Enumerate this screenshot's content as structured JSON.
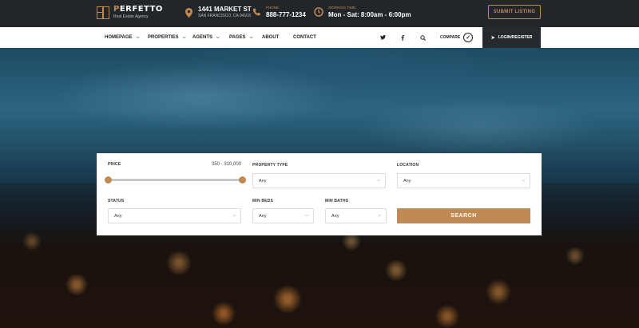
{
  "brand": {
    "first_letter": "P",
    "rest": "ERFETTO",
    "tagline": "Real Estate Agency"
  },
  "topbar": {
    "address_main": "1441 MARKET ST",
    "address_sub": "SAN FRANCISCO, CA 94103",
    "phone_label": "PHONE:",
    "phone": "888-777-1234",
    "hours_label": "WORKING TIME:",
    "hours": "Mon - Sat: 8:00am - 6:00pm",
    "submit_label": "SUBMIT LISTING"
  },
  "nav": {
    "items": [
      {
        "label": "HOMEPAGE",
        "has_dropdown": true
      },
      {
        "label": "PROPERTIES",
        "has_dropdown": true
      },
      {
        "label": "AGENTS",
        "has_dropdown": true
      },
      {
        "label": "PAGES",
        "has_dropdown": true
      },
      {
        "label": "ABOUT",
        "has_dropdown": false
      },
      {
        "label": "CONTACT",
        "has_dropdown": false
      }
    ],
    "icons": [
      "twitter-icon",
      "facebook-icon",
      "search-icon"
    ],
    "compare_label": "COMPARE",
    "login_label": "LOGIN/REGISTER"
  },
  "search": {
    "price_label": "PRICE",
    "price_range": "350 - 310,000",
    "property_type_label": "PROPERTY TYPE",
    "property_type_value": "Any",
    "location_label": "LOCATION",
    "location_value": "Any",
    "status_label": "STATUS",
    "status_value": "Any",
    "min_beds_label": "MIN BEDS",
    "min_beds_value": "Any",
    "min_baths_label": "MIN BATHS",
    "min_baths_value": "Any",
    "search_label": "SEARCH",
    "slider_min_fraction": 0.0,
    "slider_max_fraction": 1.0
  },
  "colors": {
    "accent": "#c08a53",
    "topbar_bg": "#22262b",
    "login_bg": "#262a2f"
  }
}
